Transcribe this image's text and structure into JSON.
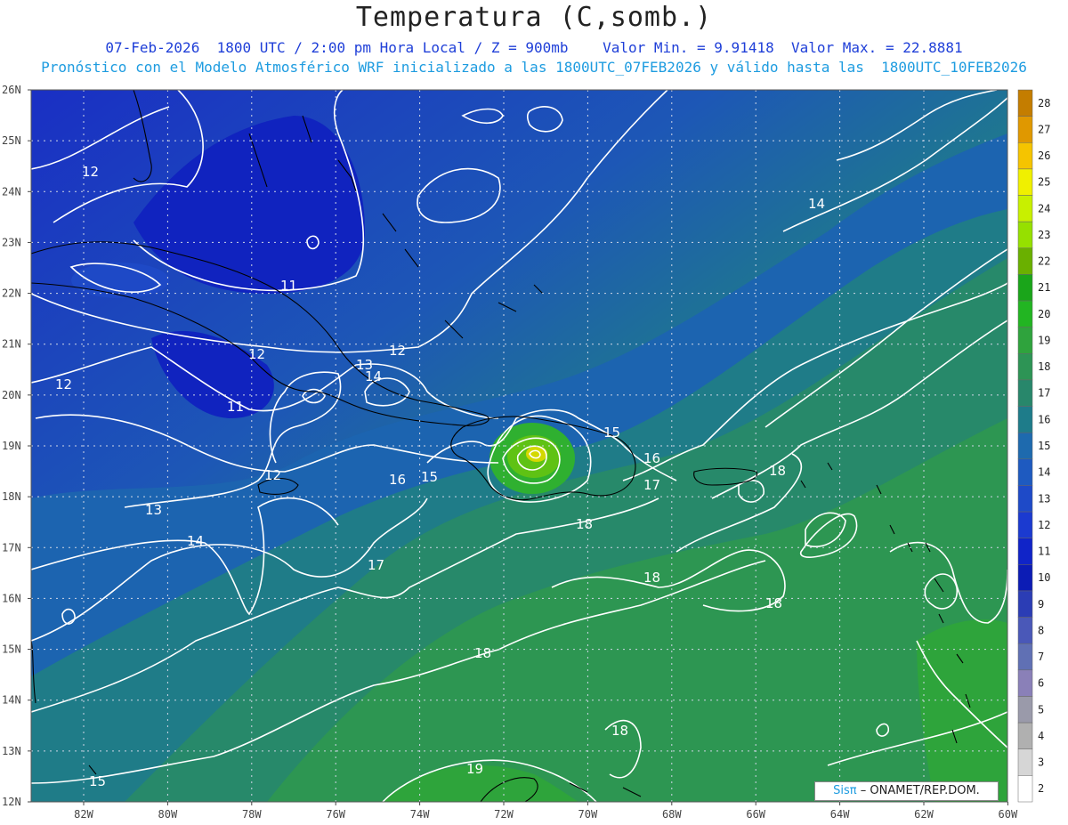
{
  "title": "Temperatura (C,somb.)",
  "subtitle_line1": "07-Feb-2026  1800 UTC / 2:00 pm Hora Local / Z = 900mb    Valor Min. = 9.91418  Valor Max. = 22.8881",
  "subtitle_line2": "Pronóstico con el Modelo Atmosférico WRF inicializado a las 1800UTC_07FEB2026 y válido hasta las  1800UTC_10FEB2026",
  "credit": {
    "brand": "Sisπ",
    "text": "– ONAMET/REP.DOM."
  },
  "axes": {
    "lat_labels": [
      "26N",
      "25N",
      "24N",
      "23N",
      "22N",
      "21N",
      "20N",
      "19N",
      "18N",
      "17N",
      "16N",
      "15N",
      "14N",
      "13N",
      "12N"
    ],
    "lon_labels": [
      "82W",
      "80W",
      "78W",
      "76W",
      "74W",
      "72W",
      "70W",
      "68W",
      "66W",
      "64W",
      "62W",
      "60W"
    ]
  },
  "colorbar": {
    "labels": [
      "28",
      "27",
      "26",
      "25",
      "24",
      "23",
      "22",
      "21",
      "20",
      "19",
      "18",
      "17",
      "16",
      "15",
      "14",
      "13",
      "12",
      "11",
      "10",
      "9",
      "8",
      "7",
      "6",
      "5",
      "4",
      "3",
      "2"
    ],
    "colors": [
      "#c47d00",
      "#e09800",
      "#f5c400",
      "#f0f000",
      "#c8f000",
      "#96e000",
      "#6ab000",
      "#1aa51a",
      "#22b522",
      "#2fa33d",
      "#2d9455",
      "#28876b",
      "#1e7c8a",
      "#1e6aae",
      "#1e5ac0",
      "#1e4ac8",
      "#1b3ad0",
      "#1024c8",
      "#0c1cb5",
      "#2b3db5",
      "#4a58b8",
      "#6070b4",
      "#8a80b8",
      "#9a9aaa",
      "#b0b0b0",
      "#d6d6d6",
      "#ffffff"
    ]
  },
  "contour_labels": [
    "12",
    "11",
    "12",
    "12",
    "11",
    "13",
    "14",
    "12",
    "13",
    "14",
    "16",
    "15",
    "15",
    "16",
    "17",
    "18",
    "18",
    "17",
    "18",
    "18",
    "18",
    "19",
    "15",
    "14",
    "18",
    "12"
  ],
  "values": {
    "min": 9.91418,
    "max": 22.8881,
    "level": "900mb"
  }
}
